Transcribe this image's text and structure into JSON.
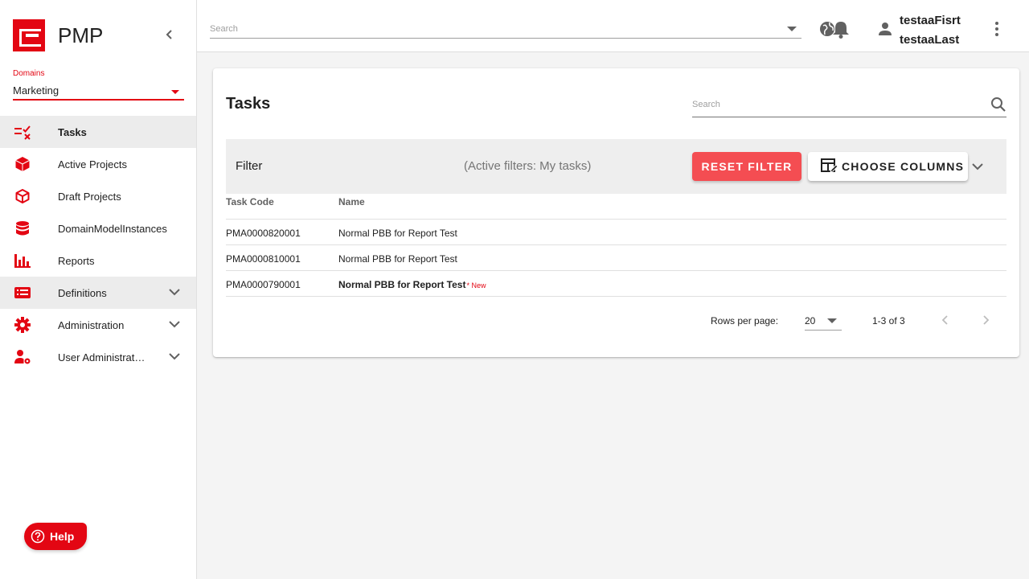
{
  "app": {
    "name": "PMP"
  },
  "domains": {
    "label": "Domains",
    "selected": "Marketing"
  },
  "sidebar": {
    "items": [
      {
        "label": "Tasks",
        "icon": "tasks-icon",
        "active": true
      },
      {
        "label": "Active Projects",
        "icon": "cube-filled-icon"
      },
      {
        "label": "Draft Projects",
        "icon": "cube-outline-icon"
      },
      {
        "label": "DomainModelInstances",
        "icon": "database-icon"
      },
      {
        "label": "Reports",
        "icon": "bar-chart-icon"
      },
      {
        "label": "Definitions",
        "icon": "list-card-icon",
        "expandable": true
      },
      {
        "label": "Administration",
        "icon": "gear-icon",
        "expandable": true
      },
      {
        "label": "User Administrat…",
        "icon": "user-gear-icon",
        "expandable": true
      }
    ]
  },
  "help": {
    "label": "Help"
  },
  "topbar": {
    "search_placeholder": "Search",
    "user": {
      "first": "testaaFisrt",
      "last": "testaaLast"
    }
  },
  "main": {
    "title": "Tasks",
    "search_placeholder": "Search",
    "filter": {
      "label": "Filter",
      "active_text": "(Active filters: My tasks)",
      "reset_label": "RESET FILTER",
      "columns_label": "CHOOSE COLUMNS"
    },
    "table": {
      "columns": [
        "Task Code",
        "Name"
      ],
      "rows": [
        {
          "code": "PMA0000820001",
          "name": "Normal PBB for Report Test",
          "is_new": false
        },
        {
          "code": "PMA0000810001",
          "name": "Normal PBB for Report Test",
          "is_new": false
        },
        {
          "code": "PMA0000790001",
          "name": "Normal PBB for Report Test",
          "is_new": true,
          "new_label": "* New"
        }
      ]
    },
    "pagination": {
      "rows_per_page_label": "Rows per page:",
      "rows_per_page": "20",
      "range": "1-3 of 3"
    }
  },
  "colors": {
    "accent": "#e30613",
    "reset_button": "#f44d52"
  }
}
